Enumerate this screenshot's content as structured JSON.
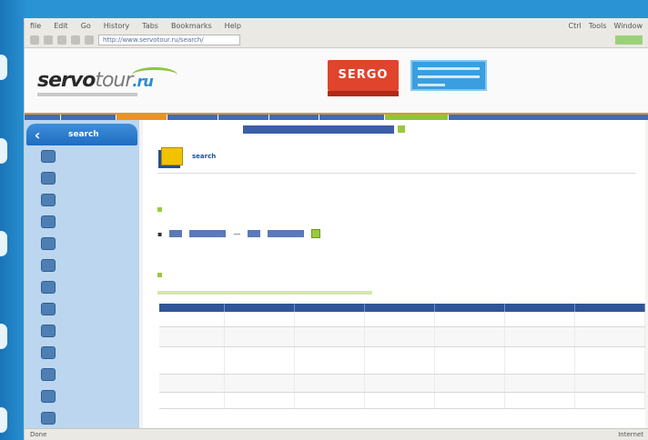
{
  "browser": {
    "menu_items": [
      "file",
      "Edit",
      "Go",
      "History",
      "Tabs",
      "Bookmarks",
      "Help"
    ],
    "menu_right": [
      "Ctrl",
      "Tools",
      "Window"
    ],
    "address": "http://www.servotour.ru/search/",
    "status_left": "Done",
    "status_right": "Internet"
  },
  "header": {
    "logo_main": "servo",
    "logo_light": "tour",
    "logo_tld": ".ru",
    "ad_red": "SERGO",
    "accent": "#e7932a"
  },
  "nav_colors": [
    "#3d6eb8",
    "#3d6eb8",
    "#e7932a",
    "#3d6eb8",
    "#3d6eb8",
    "#3d6eb8",
    "#3d6eb8",
    "#8cc63f",
    "#3d6eb8"
  ],
  "sidebar": {
    "title": "search",
    "items": [
      {
        "label": "",
        "icon": "globe-icon"
      },
      {
        "label": "",
        "icon": "folder-icon"
      },
      {
        "label": "",
        "icon": "plane-icon"
      },
      {
        "label": "",
        "icon": "hotel-icon"
      },
      {
        "label": "",
        "icon": "car-icon"
      },
      {
        "label": "",
        "icon": "ticket-icon"
      },
      {
        "label": "",
        "icon": "map-icon"
      },
      {
        "label": "",
        "icon": "info-icon"
      },
      {
        "label": "",
        "icon": "doc-icon"
      },
      {
        "label": "",
        "icon": "star-icon"
      },
      {
        "label": "",
        "icon": "phone-icon"
      },
      {
        "label": "",
        "icon": "mail-icon"
      },
      {
        "label": "",
        "icon": "user-icon"
      }
    ]
  },
  "content": {
    "user_label": "",
    "page_title": "search",
    "section1": "",
    "dash": "—",
    "section2": "",
    "table": {
      "headers": [
        "",
        "",
        "",
        "",
        "",
        "",
        ""
      ],
      "rows": [
        [
          "",
          "",
          "",
          "",
          "",
          "",
          ""
        ],
        [
          "",
          "",
          "",
          "",
          "",
          "",
          ""
        ],
        [
          "",
          "",
          "",
          "",
          "",
          "",
          ""
        ],
        [
          "",
          "",
          "",
          "",
          "",
          "",
          ""
        ],
        [
          "",
          "",
          "",
          "",
          "",
          "",
          ""
        ]
      ]
    }
  }
}
